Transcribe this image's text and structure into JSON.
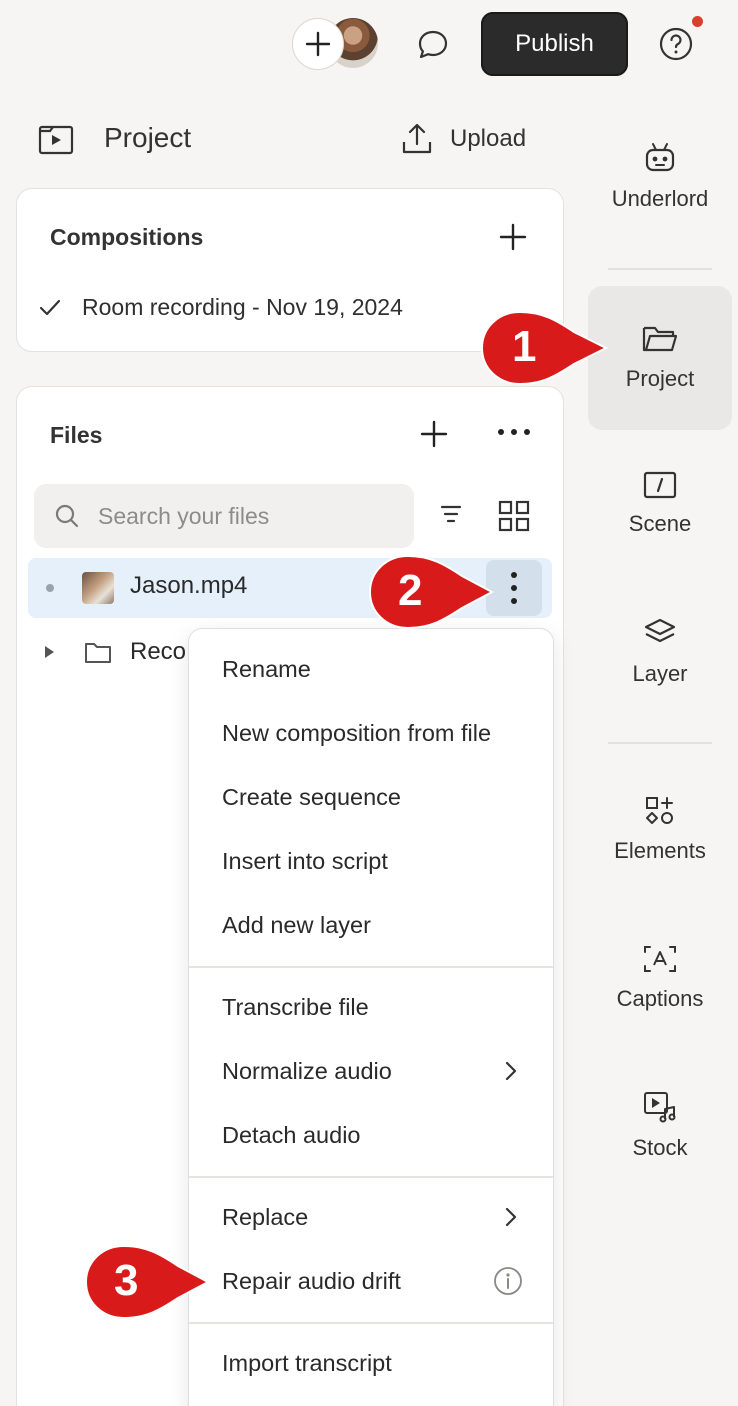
{
  "topbar": {
    "publish_label": "Publish"
  },
  "project": {
    "title": "Project",
    "upload_label": "Upload"
  },
  "compositions": {
    "title": "Compositions",
    "items": [
      "Room recording - Nov 19, 2024"
    ]
  },
  "files": {
    "title": "Files",
    "search_placeholder": "Search your files",
    "items": [
      {
        "name": "Jason.mp4",
        "type": "video"
      },
      {
        "name": "Reco",
        "type": "folder"
      }
    ]
  },
  "context_menu": {
    "items": [
      {
        "label": "Rename"
      },
      {
        "label": "New composition from file"
      },
      {
        "label": "Create sequence"
      },
      {
        "label": "Insert into script"
      },
      {
        "label": "Add new layer"
      },
      {
        "label": "Transcribe file"
      },
      {
        "label": "Normalize audio",
        "has_submenu": true
      },
      {
        "label": "Detach audio"
      },
      {
        "label": "Replace",
        "has_submenu": true
      },
      {
        "label": "Repair audio drift",
        "has_info": true
      },
      {
        "label": "Import transcript"
      }
    ]
  },
  "rail": {
    "items": [
      {
        "label": "Underlord",
        "icon": "robot-icon"
      },
      {
        "label": "Project",
        "icon": "folder-icon",
        "active": true
      },
      {
        "label": "Scene",
        "icon": "scene-icon"
      },
      {
        "label": "Layer",
        "icon": "layers-icon"
      },
      {
        "label": "Elements",
        "icon": "elements-icon"
      },
      {
        "label": "Captions",
        "icon": "captions-icon"
      },
      {
        "label": "Stock",
        "icon": "stock-media-icon"
      }
    ]
  },
  "callouts": [
    "1",
    "2",
    "3"
  ],
  "colors": {
    "callout_red": "#d91a1a",
    "selected_row": "#e5f0fa",
    "publish_bg": "#2b2b2b",
    "notification": "#d6402c"
  }
}
